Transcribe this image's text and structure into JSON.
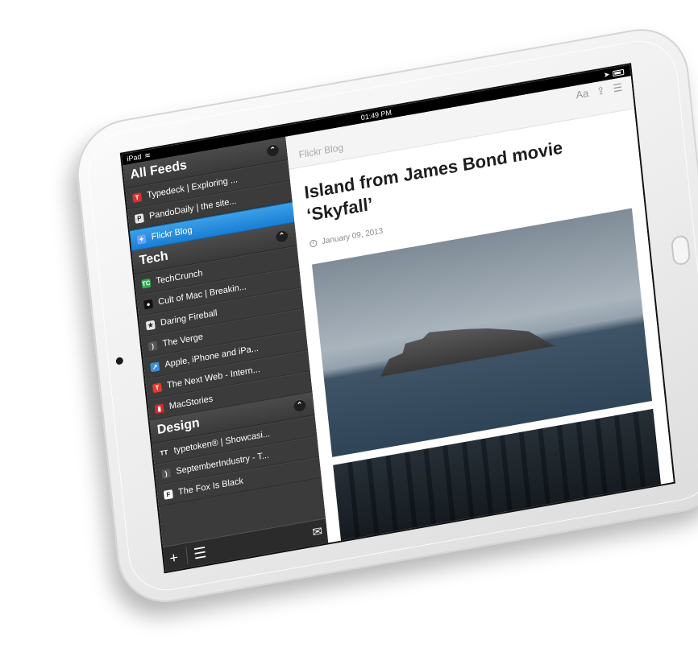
{
  "status_bar": {
    "carrier": "iPad",
    "time": "01:49 PM"
  },
  "sidebar": {
    "groups": [
      {
        "title": "All Feeds",
        "items": [
          {
            "label": "Typedeck | Exploring ...",
            "icon": "typedeck-icon",
            "color": "#d83131",
            "glyph": "T"
          },
          {
            "label": "PandoDaily | the site...",
            "icon": "pandodaily-icon",
            "color": "#e6e6e6",
            "glyph": "P"
          },
          {
            "label": "Flickr Blog",
            "icon": "flickr-icon",
            "color": "#6aa0ff",
            "glyph": "✦",
            "selected": true
          }
        ]
      },
      {
        "title": "Tech",
        "items": [
          {
            "label": "TechCrunch",
            "icon": "techcrunch-icon",
            "color": "#2cab4a",
            "glyph": "TC"
          },
          {
            "label": "Cult of Mac | Breakin...",
            "icon": "cultofmac-icon",
            "color": "#111111",
            "glyph": "●"
          },
          {
            "label": "Daring Fireball",
            "icon": "daring-fireball-icon",
            "color": "#e6e6e6",
            "glyph": "★"
          },
          {
            "label": "The Verge",
            "icon": "rss-icon",
            "color": "#555555",
            "glyph": ")"
          },
          {
            "label": "Apple, iPhone and iPa...",
            "icon": "apple-news-icon",
            "color": "#3a8fd6",
            "glyph": "↗"
          },
          {
            "label": "The Next Web - Intern...",
            "icon": "tnw-icon",
            "color": "#e03a2b",
            "glyph": "T"
          },
          {
            "label": "MacStories",
            "icon": "macstories-icon",
            "color": "#d12a2a",
            "glyph": "▮"
          }
        ]
      },
      {
        "title": "Design",
        "items": [
          {
            "label": "typetoken® | Showcasi...",
            "icon": "typetoken-icon",
            "color": "#3a3a3a",
            "glyph": "TT"
          },
          {
            "label": "SeptemberIndustry - T...",
            "icon": "rss-icon",
            "color": "#555555",
            "glyph": ")"
          },
          {
            "label": "The Fox Is Black",
            "icon": "foxisblack-icon",
            "color": "#ffffff",
            "glyph": "F"
          }
        ]
      }
    ]
  },
  "article": {
    "feed_name": "Flickr Blog",
    "title": "Island from James Bond movie ‘Skyfall’",
    "date": "January 09, 2013",
    "header_tools": [
      "Aa",
      "share-icon",
      "menu-icon"
    ]
  }
}
